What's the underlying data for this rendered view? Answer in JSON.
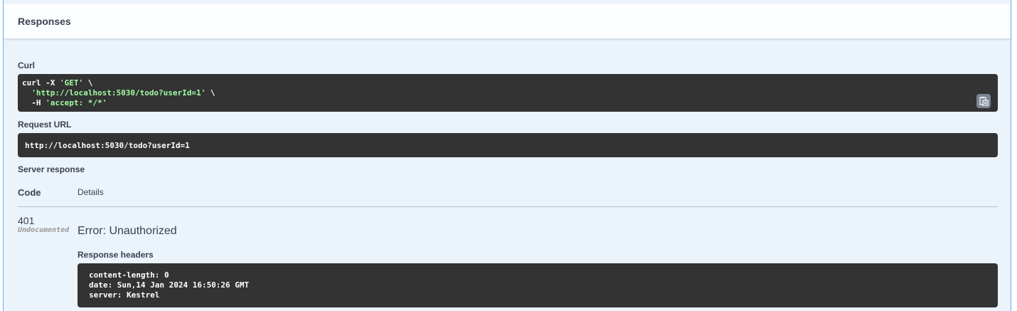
{
  "section": {
    "title": "Responses"
  },
  "curl": {
    "label": "Curl",
    "line1_cmd": "curl -X ",
    "line1_method": "'GET'",
    "line1_end": " \\",
    "line2_indent": "  ",
    "line2_url": "'http://localhost:5030/todo?userId=1'",
    "line2_end": " \\",
    "line3_flag": "  -H ",
    "line3_header": "'accept: */*'",
    "copy_icon": "clipboard-copy-icon"
  },
  "request_url": {
    "label": "Request URL",
    "value": "http://localhost:5030/todo?userId=1"
  },
  "server_response": {
    "label": "Server response",
    "col_code": "Code",
    "col_details": "Details",
    "rows": [
      {
        "code": "401",
        "undocumented": "Undocumented",
        "error": "Error: Unauthorized",
        "headers_label": "Response headers",
        "headers": [
          "content-length: 0",
          "date: Sun,14 Jan 2024 16:50:26 GMT",
          "server: Kestrel"
        ]
      }
    ]
  },
  "colors": {
    "accent": "#61affe",
    "panel_bg": "#ebf3fb",
    "code_bg": "#333333",
    "string": "#a2fca2"
  }
}
